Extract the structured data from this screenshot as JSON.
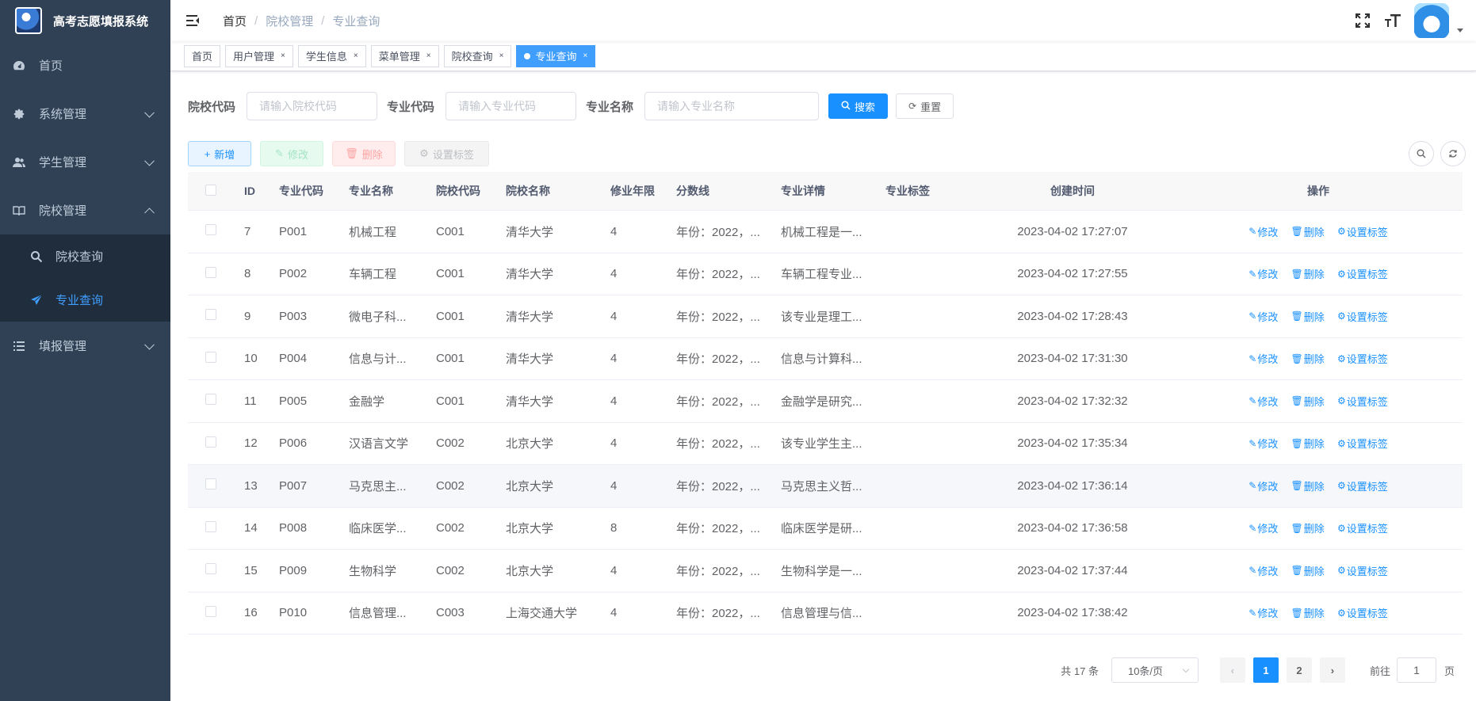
{
  "app": {
    "title": "高考志愿填报系统"
  },
  "sidebar": {
    "items": [
      {
        "label": "首页",
        "icon": "dashboard-icon"
      },
      {
        "label": "系统管理",
        "icon": "gear-icon"
      },
      {
        "label": "学生管理",
        "icon": "users-icon"
      },
      {
        "label": "院校管理",
        "icon": "book-icon"
      },
      {
        "label": "填报管理",
        "icon": "list-icon"
      }
    ],
    "sub_items": [
      {
        "label": "院校查询",
        "icon": "search-icon"
      },
      {
        "label": "专业查询",
        "icon": "paper-plane-icon"
      }
    ]
  },
  "breadcrumb": [
    "首页",
    "院校管理",
    "专业查询"
  ],
  "tags": [
    {
      "label": "首页"
    },
    {
      "label": "用户管理"
    },
    {
      "label": "学生信息"
    },
    {
      "label": "菜单管理"
    },
    {
      "label": "院校查询"
    },
    {
      "label": "专业查询"
    }
  ],
  "search": {
    "university_code_label": "院校代码",
    "university_code_placeholder": "请输入院校代码",
    "major_code_label": "专业代码",
    "major_code_placeholder": "请输入专业代码",
    "major_name_label": "专业名称",
    "major_name_placeholder": "请输入专业名称",
    "search_btn": "搜索",
    "reset_btn": "重置"
  },
  "toolbar": {
    "add": "新增",
    "edit": "修改",
    "delete": "删除",
    "set_tag": "设置标签"
  },
  "table": {
    "headers": [
      "ID",
      "专业代码",
      "专业名称",
      "院校代码",
      "院校名称",
      "修业年限",
      "分数线",
      "专业详情",
      "专业标签",
      "创建时间",
      "操作"
    ],
    "rows": [
      {
        "id": "7",
        "code": "P001",
        "name": "机械工程",
        "ucode": "C001",
        "uname": "清华大学",
        "years": "4",
        "score": "年份：2022，...",
        "detail": "机械工程是一...",
        "tag": "",
        "time": "2023-04-02 17:27:07"
      },
      {
        "id": "8",
        "code": "P002",
        "name": "车辆工程",
        "ucode": "C001",
        "uname": "清华大学",
        "years": "4",
        "score": "年份：2022，...",
        "detail": "车辆工程专业...",
        "tag": "",
        "time": "2023-04-02 17:27:55"
      },
      {
        "id": "9",
        "code": "P003",
        "name": "微电子科...",
        "ucode": "C001",
        "uname": "清华大学",
        "years": "4",
        "score": "年份：2022，...",
        "detail": "该专业是理工...",
        "tag": "",
        "time": "2023-04-02 17:28:43"
      },
      {
        "id": "10",
        "code": "P004",
        "name": "信息与计...",
        "ucode": "C001",
        "uname": "清华大学",
        "years": "4",
        "score": "年份：2022，...",
        "detail": "信息与计算科...",
        "tag": "",
        "time": "2023-04-02 17:31:30"
      },
      {
        "id": "11",
        "code": "P005",
        "name": "金融学",
        "ucode": "C001",
        "uname": "清华大学",
        "years": "4",
        "score": "年份：2022，...",
        "detail": "金融学是研究...",
        "tag": "",
        "time": "2023-04-02 17:32:32"
      },
      {
        "id": "12",
        "code": "P006",
        "name": "汉语言文学",
        "ucode": "C002",
        "uname": "北京大学",
        "years": "4",
        "score": "年份：2022，...",
        "detail": "该专业学生主...",
        "tag": "",
        "time": "2023-04-02 17:35:34"
      },
      {
        "id": "13",
        "code": "P007",
        "name": "马克思主...",
        "ucode": "C002",
        "uname": "北京大学",
        "years": "4",
        "score": "年份：2022，...",
        "detail": "马克思主义哲...",
        "tag": "",
        "time": "2023-04-02 17:36:14"
      },
      {
        "id": "14",
        "code": "P008",
        "name": "临床医学...",
        "ucode": "C002",
        "uname": "北京大学",
        "years": "8",
        "score": "年份：2022，...",
        "detail": "临床医学是研...",
        "tag": "",
        "time": "2023-04-02 17:36:58"
      },
      {
        "id": "15",
        "code": "P009",
        "name": "生物科学",
        "ucode": "C002",
        "uname": "北京大学",
        "years": "4",
        "score": "年份：2022，...",
        "detail": "生物科学是一...",
        "tag": "",
        "time": "2023-04-02 17:37:44"
      },
      {
        "id": "16",
        "code": "P010",
        "name": "信息管理...",
        "ucode": "C003",
        "uname": "上海交通大学",
        "years": "4",
        "score": "年份：2022，...",
        "detail": "信息管理与信...",
        "tag": "",
        "time": "2023-04-02 17:38:42"
      }
    ],
    "ops": {
      "edit": "修改",
      "delete": "删除",
      "set_tag": "设置标签"
    }
  },
  "pagination": {
    "total": "共 17 条",
    "page_size": "10条/页",
    "pages": [
      "1",
      "2"
    ],
    "current": "1",
    "goto_prefix": "前往",
    "goto_value": "1",
    "goto_suffix": "页"
  },
  "colors": {
    "sidebar_bg": "#304156",
    "submenu_bg": "#1f2d3d",
    "primary": "#1890ff",
    "active_menu": "#409eff"
  }
}
